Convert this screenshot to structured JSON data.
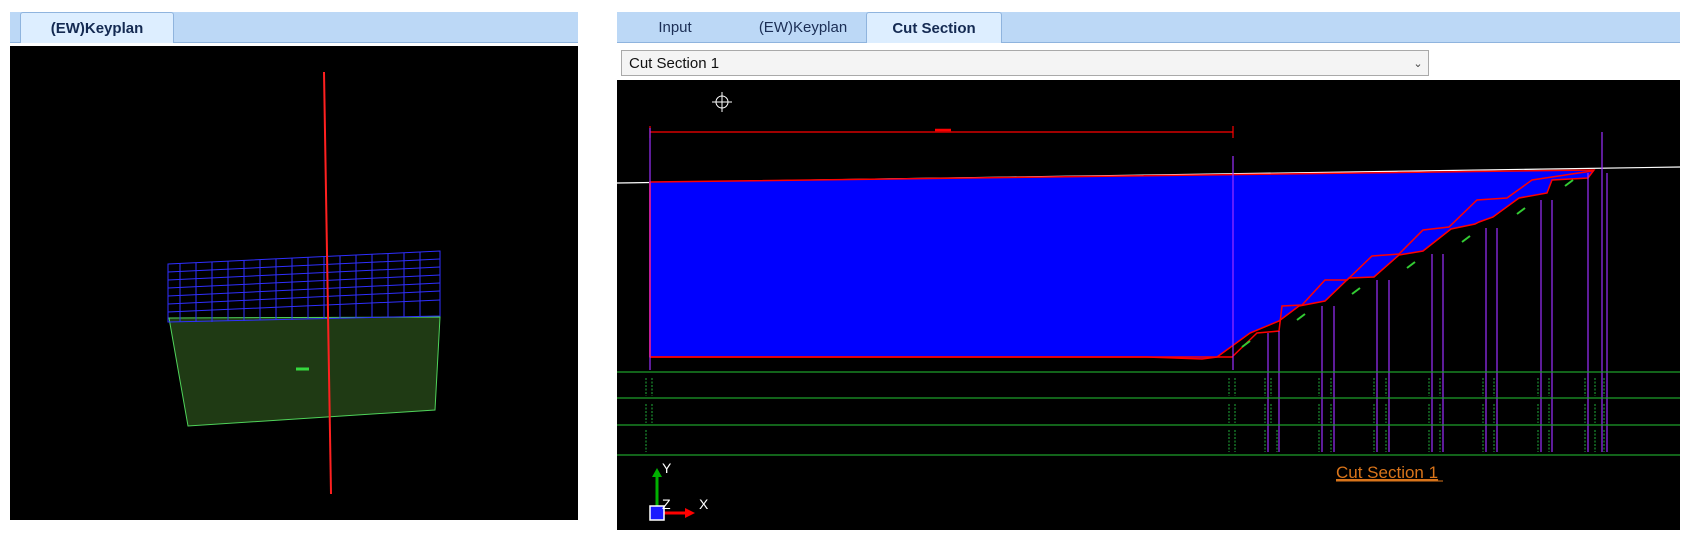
{
  "left_panel": {
    "tabs": [
      {
        "label": "(EW)Keyplan",
        "active": true
      }
    ]
  },
  "right_panel": {
    "tabs": [
      {
        "label": "Input",
        "active": false
      },
      {
        "label": "(EW)Keyplan",
        "active": false
      },
      {
        "label": "Cut Section",
        "active": true
      }
    ],
    "section_select": {
      "value": "Cut Section 1"
    },
    "drawing_title": "Cut Section 1",
    "axis_labels": {
      "y": "Y",
      "z": "Z",
      "x": "X"
    }
  },
  "colors": {
    "viewport_bg": "#000000",
    "section_fill": "#0000ff",
    "section_outline": "#ff0000",
    "grid_lines": "#1e9e2a",
    "vertical_markers": "#9b30ff",
    "title_text": "#d9741a"
  }
}
